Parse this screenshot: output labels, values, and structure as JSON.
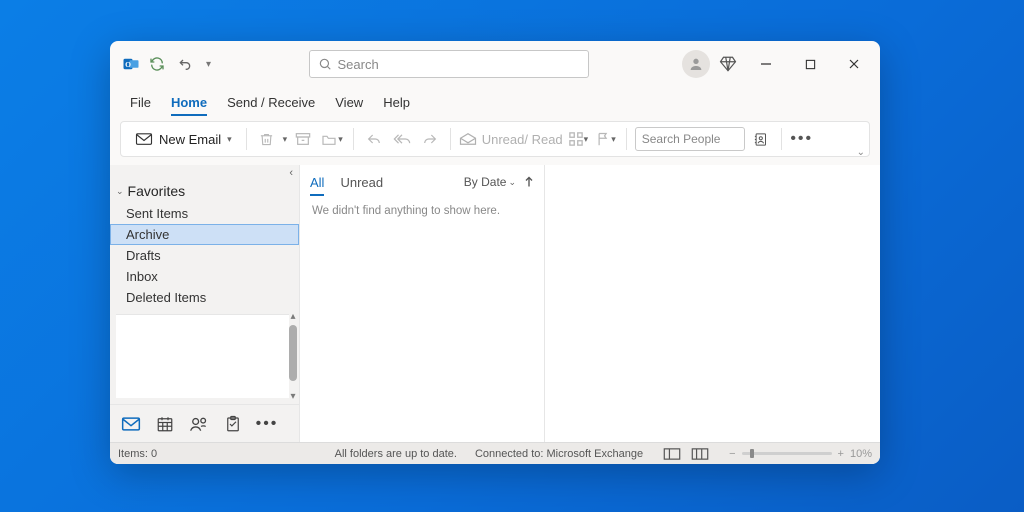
{
  "titlebar": {
    "search_placeholder": "Search"
  },
  "menubar": {
    "items": [
      {
        "label": "File"
      },
      {
        "label": "Home"
      },
      {
        "label": "Send / Receive"
      },
      {
        "label": "View"
      },
      {
        "label": "Help"
      }
    ],
    "active_index": 1
  },
  "ribbon": {
    "new_email_label": "New Email",
    "unread_read_label": "Unread/ Read",
    "search_people_placeholder": "Search People"
  },
  "nav": {
    "favorites_label": "Favorites",
    "items": [
      {
        "label": "Sent Items"
      },
      {
        "label": "Archive"
      },
      {
        "label": "Drafts"
      },
      {
        "label": "Inbox"
      },
      {
        "label": "Deleted Items"
      }
    ],
    "selected_index": 1
  },
  "list": {
    "tabs": [
      {
        "label": "All"
      },
      {
        "label": "Unread"
      }
    ],
    "active_tab": 0,
    "sort_label": "By Date",
    "empty_message": "We didn't find anything to show here."
  },
  "status": {
    "items_label": "Items: 0",
    "sync_label": "All folders are up to date.",
    "connected_label": "Connected to: Microsoft Exchange",
    "zoom_label": "10%"
  }
}
